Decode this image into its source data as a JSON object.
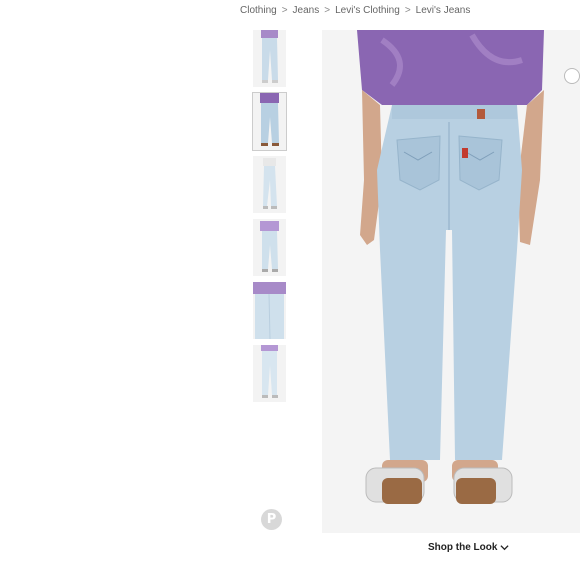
{
  "breadcrumb": {
    "items": [
      "Clothing",
      "Jeans",
      "Levi's Clothing",
      "Levi's Jeans"
    ],
    "separator": ">"
  },
  "thumbnails": [
    {
      "view": "front",
      "selected": false
    },
    {
      "view": "back",
      "selected": true
    },
    {
      "view": "side",
      "selected": false
    },
    {
      "view": "front-full",
      "selected": false
    },
    {
      "view": "detail",
      "selected": false
    },
    {
      "view": "front-legs",
      "selected": false
    }
  ],
  "social": {
    "pinterest_icon": "pinterest-icon",
    "pinterest_glyph": "P"
  },
  "shop_the_look": {
    "label": "Shop the Look",
    "icon": "chevron-down-icon"
  },
  "colors": {
    "denim": "#b8d0e2",
    "tshirt": "#8a66b2",
    "skin": "#d2a78c",
    "background": "#f4f4f4"
  }
}
